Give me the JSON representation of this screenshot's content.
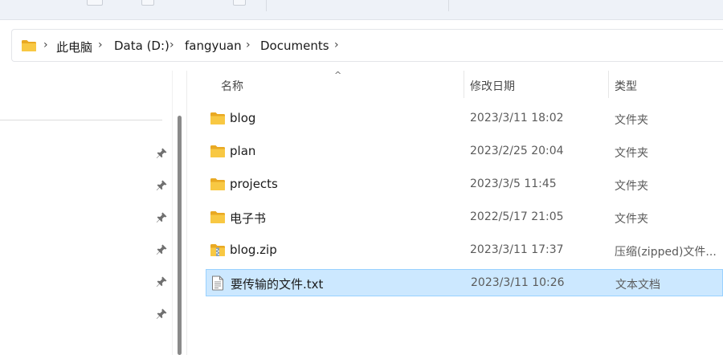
{
  "breadcrumb": {
    "items": [
      "此电脑",
      "Data (D:)",
      "fangyuan",
      "Documents"
    ],
    "separator": "›"
  },
  "columns": {
    "name": "名称",
    "modified": "修改日期",
    "type": "类型",
    "sort_indicator": "^"
  },
  "files": [
    {
      "name": "blog",
      "modified": "2023/3/11 18:02",
      "type": "文件夹",
      "icon": "folder-icon",
      "selected": false
    },
    {
      "name": "plan",
      "modified": "2023/2/25 20:04",
      "type": "文件夹",
      "icon": "folder-icon",
      "selected": false
    },
    {
      "name": "projects",
      "modified": "2023/3/5 11:45",
      "type": "文件夹",
      "icon": "folder-icon",
      "selected": false
    },
    {
      "name": "电子书",
      "modified": "2022/5/17 21:05",
      "type": "文件夹",
      "icon": "folder-icon",
      "selected": false
    },
    {
      "name": "blog.zip",
      "modified": "2023/3/11 17:37",
      "type": "压缩(zipped)文件...",
      "icon": "zip-folder-icon",
      "selected": false
    },
    {
      "name": "要传输的文件.txt",
      "modified": "2023/3/11 10:26",
      "type": "文本文档",
      "icon": "text-file-icon",
      "selected": true
    }
  ],
  "colors": {
    "selection_bg": "#cce8ff",
    "selection_border": "#99d1ff",
    "folder": "#f8c843"
  }
}
